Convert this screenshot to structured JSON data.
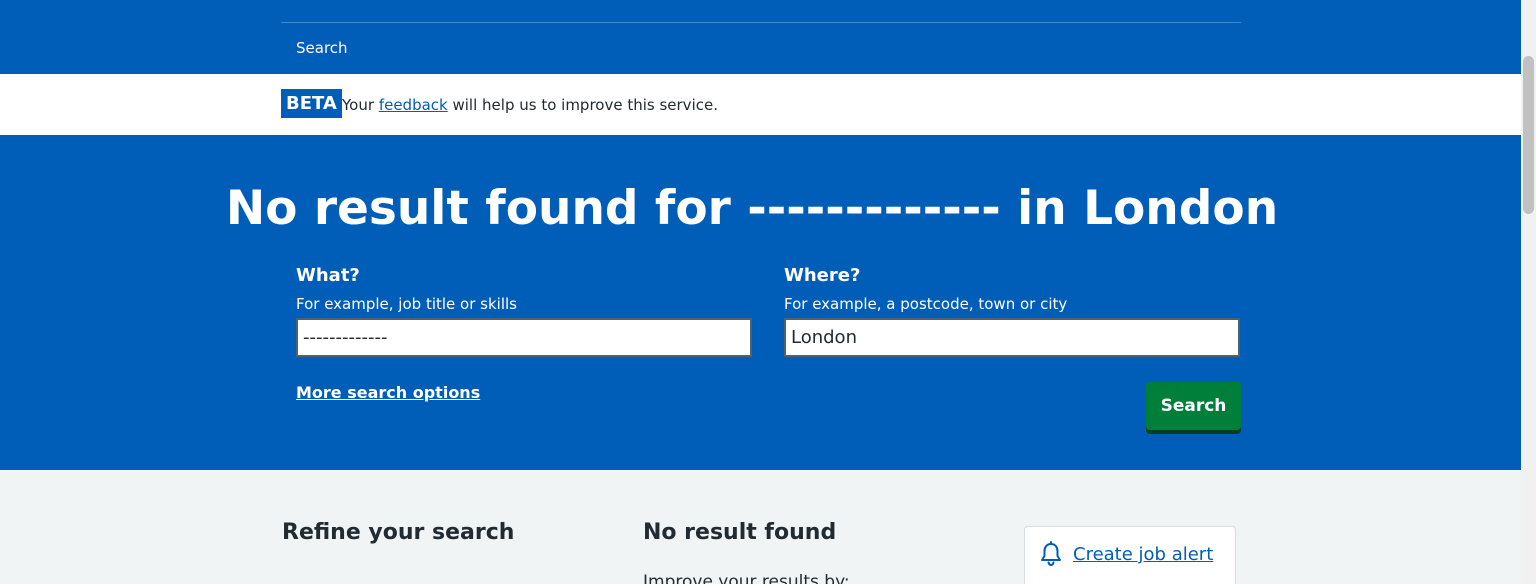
{
  "nav": {
    "search_label": "Search"
  },
  "beta_banner": {
    "tag": "BETA",
    "text_before": "Your",
    "link_text": "feedback",
    "text_after": "will help us to improve this service."
  },
  "hero": {
    "heading": "No result found for ------------- in London",
    "what": {
      "label": "What?",
      "hint": "For example, job title or skills",
      "value": "-------------"
    },
    "where": {
      "label": "Where?",
      "hint": "For example, a postcode, town or city",
      "value": "London"
    },
    "more_options": "More search options",
    "search_button": "Search"
  },
  "results": {
    "refine_title": "Refine your search",
    "title": "No result found",
    "subtitle": "Improve your results by:"
  },
  "alert": {
    "icon": "bell-icon",
    "link_text": "Create job alert"
  },
  "colors": {
    "brand_blue": "#005eb8",
    "button_green": "#007f3b",
    "background": "#f0f4f5"
  }
}
